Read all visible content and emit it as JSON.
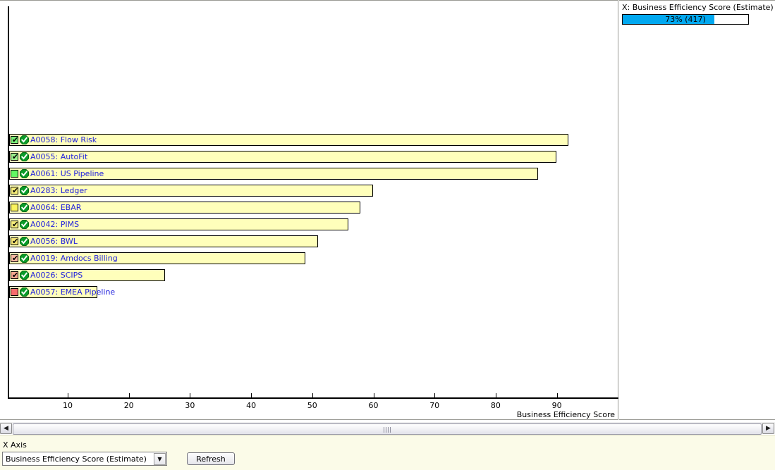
{
  "chart_data": {
    "type": "bar",
    "orientation": "horizontal",
    "title": "",
    "xlabel": "Business Efficiency Score",
    "ylabel": "",
    "xlim": [
      0,
      97
    ],
    "xticks": [
      10,
      20,
      30,
      40,
      50,
      60,
      70,
      80,
      90
    ],
    "grid": false,
    "categories": [
      "A0058: Flow Risk",
      "A0055: AutoFit",
      "A0061: US Pipeline",
      "A0283: Ledger",
      "A0064: EBAR",
      "A0042: PIMS",
      "A0056: BWL",
      "A0019: Amdocs Billing",
      "A0026: SCIPS",
      "A0057: EMEA Pipeline"
    ],
    "values": [
      91,
      89,
      86,
      59,
      57,
      55,
      50,
      48,
      25,
      14
    ],
    "bar_color": "#ffffbb",
    "bar_border_color": "#000000",
    "label_color": "#2222dd"
  },
  "rows": [
    {
      "label": "A0058: Flow Risk",
      "value": 91,
      "checkbox_color": "#77ef77",
      "checked": true,
      "status_icon": "check-circle-icon"
    },
    {
      "label": "A0055: AutoFit",
      "value": 89,
      "checkbox_color": "#9cf08c",
      "checked": true,
      "status_icon": "check-circle-icon"
    },
    {
      "label": "A0061: US Pipeline",
      "value": 86,
      "checkbox_color": "#63f763",
      "checked": false,
      "status_icon": "check-circle-icon"
    },
    {
      "label": "A0283: Ledger",
      "value": 59,
      "checkbox_color": "#f6ee7a",
      "checked": true,
      "status_icon": "check-circle-icon"
    },
    {
      "label": "A0064: EBAR",
      "value": 57,
      "checkbox_color": "#fbf45e",
      "checked": false,
      "status_icon": "check-circle-icon"
    },
    {
      "label": "A0042: PIMS",
      "value": 55,
      "checkbox_color": "#f7ef7d",
      "checked": true,
      "status_icon": "check-circle-icon"
    },
    {
      "label": "A0056: BWL",
      "value": 50,
      "checkbox_color": "#f8e877",
      "checked": true,
      "status_icon": "check-circle-icon"
    },
    {
      "label": "A0019: Amdocs Billing",
      "value": 48,
      "checkbox_color": "#f7b9a4",
      "checked": true,
      "status_icon": "check-circle-icon"
    },
    {
      "label": "A0026: SCIPS",
      "value": 25,
      "checkbox_color": "#f6a78f",
      "checked": true,
      "status_icon": "check-circle-icon"
    },
    {
      "label": "A0057: EMEA Pipeline",
      "value": 14,
      "checkbox_color": "#f86c6c",
      "checked": false,
      "status_icon": "check-circle-icon"
    }
  ],
  "checkbox_tick_glyph": "✔",
  "legend": {
    "title": "X: Business Efficiency Score (Estimate)",
    "progress_text": "73% (417)",
    "progress_percent": 73,
    "progress_color": "#00a8f0"
  },
  "scrollbar": {
    "left_arrow_glyph": "◀",
    "right_arrow_glyph": "▶"
  },
  "controls": {
    "x_axis_caption": "X Axis",
    "x_axis_selected": "Business Efficiency Score (Estimate)",
    "x_axis_options": [
      "Business Efficiency Score (Estimate)"
    ],
    "dropdown_arrow_glyph": "▼",
    "refresh_label": "Refresh"
  }
}
